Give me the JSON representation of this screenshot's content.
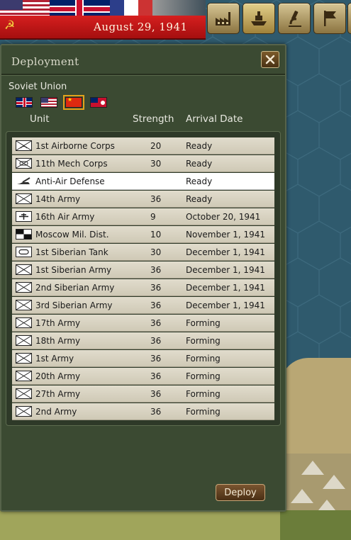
{
  "topbar": {
    "date": "August 29, 1941",
    "buttons": [
      {
        "name": "production-button",
        "icon": "factory-icon"
      },
      {
        "name": "deployment-button",
        "icon": "ship-icon",
        "active": true
      },
      {
        "name": "research-button",
        "icon": "microscope-icon"
      },
      {
        "name": "objectives-button",
        "icon": "flag-icon"
      }
    ]
  },
  "panel": {
    "title": "Deployment",
    "nation": "Soviet Union",
    "nation_flags": [
      "uk-flag-icon",
      "us-flag-icon",
      "china-flag-icon",
      "hong-kong-flag-icon"
    ],
    "columns": {
      "unit": "Unit",
      "strength": "Strength",
      "arrival": "Arrival Date"
    },
    "units": [
      {
        "icon": "airborne",
        "name": "1st Airborne Corps",
        "strength": "20",
        "arrival": "Ready"
      },
      {
        "icon": "mech",
        "name": "11th Mech Corps",
        "strength": "30",
        "arrival": "Ready"
      },
      {
        "icon": "anti-air",
        "name": "Anti-Air Defense",
        "strength": "",
        "arrival": "Ready",
        "selected": true
      },
      {
        "icon": "infantry",
        "name": "14th Army",
        "strength": "36",
        "arrival": "Ready"
      },
      {
        "icon": "air",
        "name": "16th Air Army",
        "strength": "9",
        "arrival": "October 20, 1941"
      },
      {
        "icon": "hq",
        "name": "Moscow Mil. Dist.",
        "strength": "10",
        "arrival": "November 1, 1941"
      },
      {
        "icon": "armor",
        "name": "1st Siberian Tank",
        "strength": "30",
        "arrival": "December 1, 1941"
      },
      {
        "icon": "infantry",
        "name": "1st Siberian Army",
        "strength": "36",
        "arrival": "December 1, 1941"
      },
      {
        "icon": "infantry",
        "name": "2nd Siberian Army",
        "strength": "36",
        "arrival": "December 1, 1941"
      },
      {
        "icon": "infantry",
        "name": "3rd Siberian Army",
        "strength": "36",
        "arrival": "December 1, 1941"
      },
      {
        "icon": "infantry",
        "name": "17th Army",
        "strength": "36",
        "arrival": "Forming"
      },
      {
        "icon": "infantry",
        "name": "18th Army",
        "strength": "36",
        "arrival": "Forming"
      },
      {
        "icon": "infantry",
        "name": "1st Army",
        "strength": "36",
        "arrival": "Forming"
      },
      {
        "icon": "infantry",
        "name": "20th Army",
        "strength": "36",
        "arrival": "Forming"
      },
      {
        "icon": "infantry",
        "name": "27th Army",
        "strength": "36",
        "arrival": "Forming"
      },
      {
        "icon": "infantry",
        "name": "2nd Army",
        "strength": "36",
        "arrival": "Forming"
      }
    ],
    "deploy_label": "Deploy"
  },
  "colors": {
    "accent": "#e0a21c",
    "panel_bg": "#3b4a32",
    "selected_row": "#ffffff"
  }
}
